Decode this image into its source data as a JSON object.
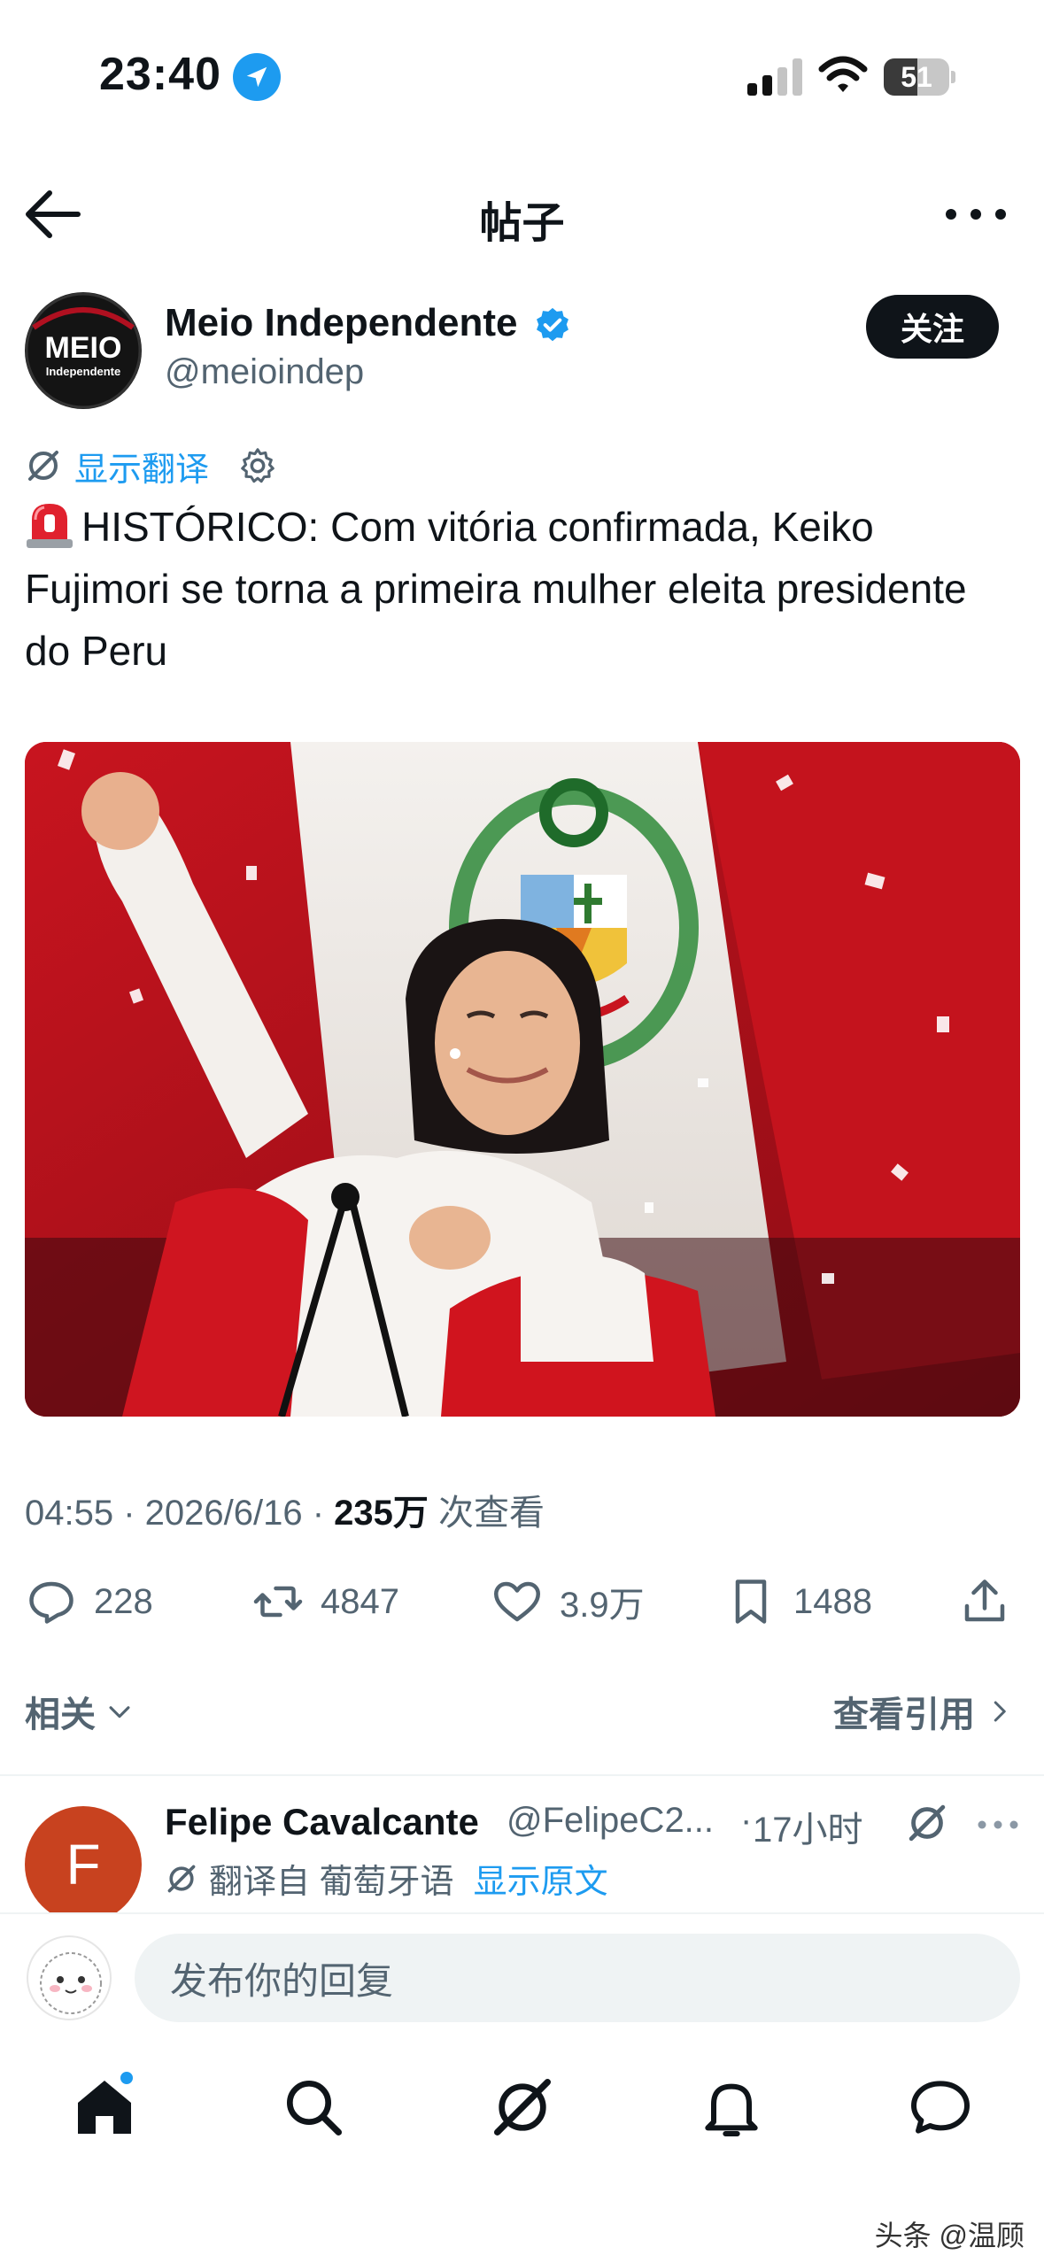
{
  "status_bar": {
    "time": "23:40",
    "battery": "51",
    "battery_level": 0.51
  },
  "header": {
    "title": "帖子"
  },
  "post": {
    "author_name": "Meio Independente",
    "author_handle": "@meioindep",
    "avatar_text_main": "MEIO",
    "avatar_text_sub": "Independente",
    "follow_label": "关注",
    "translate_label": "显示翻译",
    "text": "HISTÓRICO: Com vitória confirmada, Keiko Fujimori se torna a primeira mulher eleita presidente do Peru",
    "meta_time": "04:55 · 2026/6/16 · ",
    "views_count": "235万",
    "views_label": " 次查看",
    "replies": "228",
    "reposts": "4847",
    "likes": "3.9万",
    "bookmarks": "1488"
  },
  "related_label": "相关",
  "view_quotes_label": "查看引用",
  "reply": {
    "avatar_letter": "F",
    "name": "Felipe Cavalcante",
    "handle": "@FelipeC2...",
    "separator": "·",
    "time": "17小时",
    "translated_from": "翻译自 葡萄牙语",
    "show_original": "显示原文"
  },
  "composer": {
    "placeholder": "发布你的回复"
  },
  "watermark": "头条 @温顾",
  "colors": {
    "accent": "#1d9bf0",
    "text": "#0f1419",
    "muted": "#536471",
    "flag_red": "#c8141f"
  },
  "icons": [
    "location-arrow-icon",
    "signal-icon",
    "wifi-icon",
    "battery-icon",
    "back-arrow-icon",
    "more-icon",
    "verified-badge-icon",
    "grok-icon",
    "gear-icon",
    "siren-emoji",
    "reply-icon",
    "repost-icon",
    "like-icon",
    "bookmark-icon",
    "share-icon",
    "chevron-down-icon",
    "chevron-right-icon",
    "home-icon",
    "search-icon",
    "grok-tab-icon",
    "bell-icon",
    "messages-icon"
  ]
}
